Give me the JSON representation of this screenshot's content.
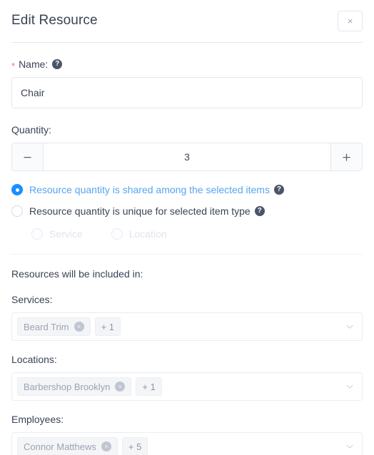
{
  "modal": {
    "title": "Edit Resource",
    "close_label": "×"
  },
  "name_field": {
    "required_marker": "*",
    "label": "Name:",
    "help": "?",
    "value": "Chair"
  },
  "quantity_field": {
    "label": "Quantity:",
    "value": "3",
    "decrement_label": "−",
    "increment_label": "+"
  },
  "sharing_options": {
    "shared": {
      "label": "Resource quantity is shared among the selected items",
      "help": "?",
      "selected": true
    },
    "unique": {
      "label": "Resource quantity is unique for selected item type",
      "help": "?",
      "selected": false
    },
    "sub_options": [
      {
        "label": "Service",
        "selected": false,
        "disabled": true
      },
      {
        "label": "Location",
        "selected": false,
        "disabled": true
      }
    ]
  },
  "inclusion": {
    "heading": "Resources will be included in:",
    "groups": [
      {
        "label": "Services:",
        "tags": [
          {
            "text": "Beard Trim",
            "remove": "×"
          }
        ],
        "overflow": "+ 1"
      },
      {
        "label": "Locations:",
        "tags": [
          {
            "text": "Barbershop Brooklyn",
            "remove": "×"
          }
        ],
        "overflow": "+ 1"
      },
      {
        "label": "Employees:",
        "tags": [
          {
            "text": "Connor Matthews",
            "remove": "×"
          }
        ],
        "overflow": "+ 5"
      }
    ]
  },
  "colors": {
    "accent": "#1890ff",
    "link": "#55a5f0",
    "text": "#3b4256",
    "required": "#f5707a",
    "border": "#e4e7ee",
    "tag_bg": "#f4f5f7"
  }
}
